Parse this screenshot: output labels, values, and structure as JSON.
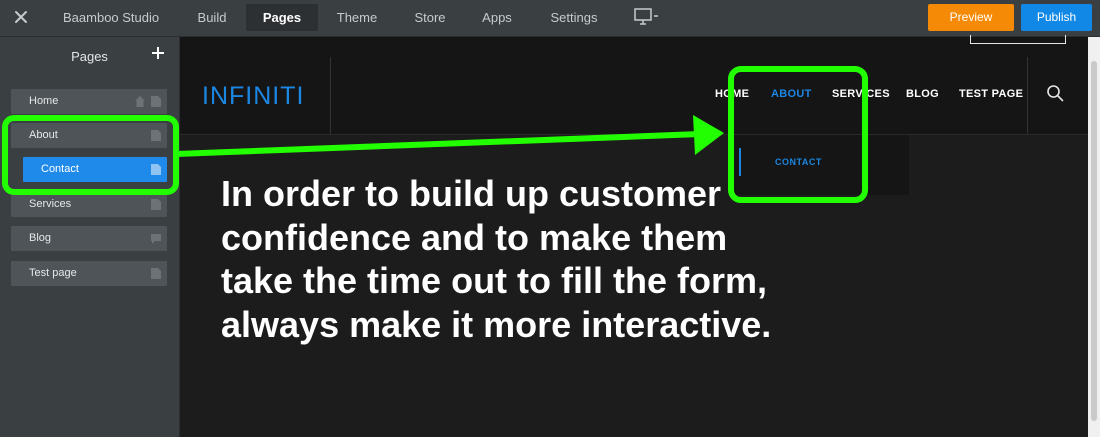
{
  "topbar": {
    "brand": "Baamboo Studio",
    "nav": [
      "Build",
      "Pages",
      "Theme",
      "Store",
      "Apps",
      "Settings"
    ],
    "active_nav": "Pages",
    "preview_label": "Preview",
    "publish_label": "Publish",
    "colors": {
      "preview": "#f58a07",
      "publish": "#1188e6"
    }
  },
  "sidebar": {
    "title": "Pages",
    "items": [
      {
        "label": "Home",
        "icons": [
          "home-icon",
          "page-icon"
        ]
      },
      {
        "label": "About",
        "icons": [
          "page-icon"
        ]
      },
      {
        "label": "Contact",
        "icons": [
          "page-icon"
        ],
        "active": true
      },
      {
        "label": "Services",
        "icons": [
          "page-icon"
        ]
      },
      {
        "label": "Blog",
        "icons": [
          "comment-icon"
        ]
      },
      {
        "label": "Test page",
        "icons": [
          "page-icon"
        ]
      }
    ]
  },
  "site": {
    "logo": "INFINITI",
    "nav": [
      "HOME",
      "ABOUT",
      "SERVICES",
      "BLOG",
      "TEST PAGE"
    ],
    "active_nav": "ABOUT",
    "dropdown_item": "CONTACT",
    "headline": "In order to build up customer confidence and to make them take the time out to fill the form, always make it more interactive.",
    "accent": "#1c86e3"
  },
  "annotation": {
    "color": "#22ff00"
  }
}
